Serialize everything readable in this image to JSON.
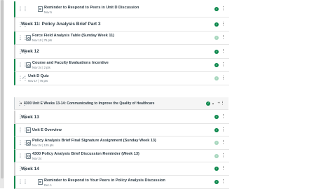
{
  "items": [
    {
      "type": "doc",
      "title": "Reminder to Respond to Peers in Unit D Discussion",
      "meta": "Nov 5"
    },
    {
      "type": "subheader",
      "title": "Week 11: Policy Analysis Brief Part 3"
    },
    {
      "type": "asg",
      "title": "Force Field Analysis Table (Sunday Week 11)",
      "meta": "Nov 10  |  75 pts"
    },
    {
      "type": "subheader",
      "title": "Week 12"
    },
    {
      "type": "asg",
      "title": "Course and Faculty Evaluations Incentive",
      "meta": "Nov 24  |  2 pts"
    },
    {
      "type": "quiz",
      "title": "Unit D Quiz",
      "meta": "Nov 17  |  75 pts"
    },
    {
      "type": "module",
      "title": "4300 Unit E Weeks 13-14: Communicating to Improve the Quality of Healthcare"
    },
    {
      "type": "subheader",
      "title": "Week 13"
    },
    {
      "type": "doc",
      "title": "Unit E Overview",
      "meta": ""
    },
    {
      "type": "asg",
      "title": "Policy Analysis Brief Final Signature Assignment (Sunday Week 13)",
      "meta": "Nov 24  |  125 pts"
    },
    {
      "type": "asg",
      "title": "4300 Policy Analysis Brief Discussion Reminder (Week 13)",
      "meta": "Nov 24"
    },
    {
      "type": "subheader",
      "title": "Week 14"
    },
    {
      "type": "doc",
      "title": "Reminder to Respond to Your Peers in Policy Analysis Discussion",
      "meta": "Dec 1"
    }
  ],
  "icons": {
    "drag": "drag-handle-icon",
    "check": "published-check-icon",
    "menu": "kebab-menu-icon",
    "plus": "add-icon"
  },
  "colors": {
    "published": "#0b874b",
    "border_green": "#0b874b"
  }
}
